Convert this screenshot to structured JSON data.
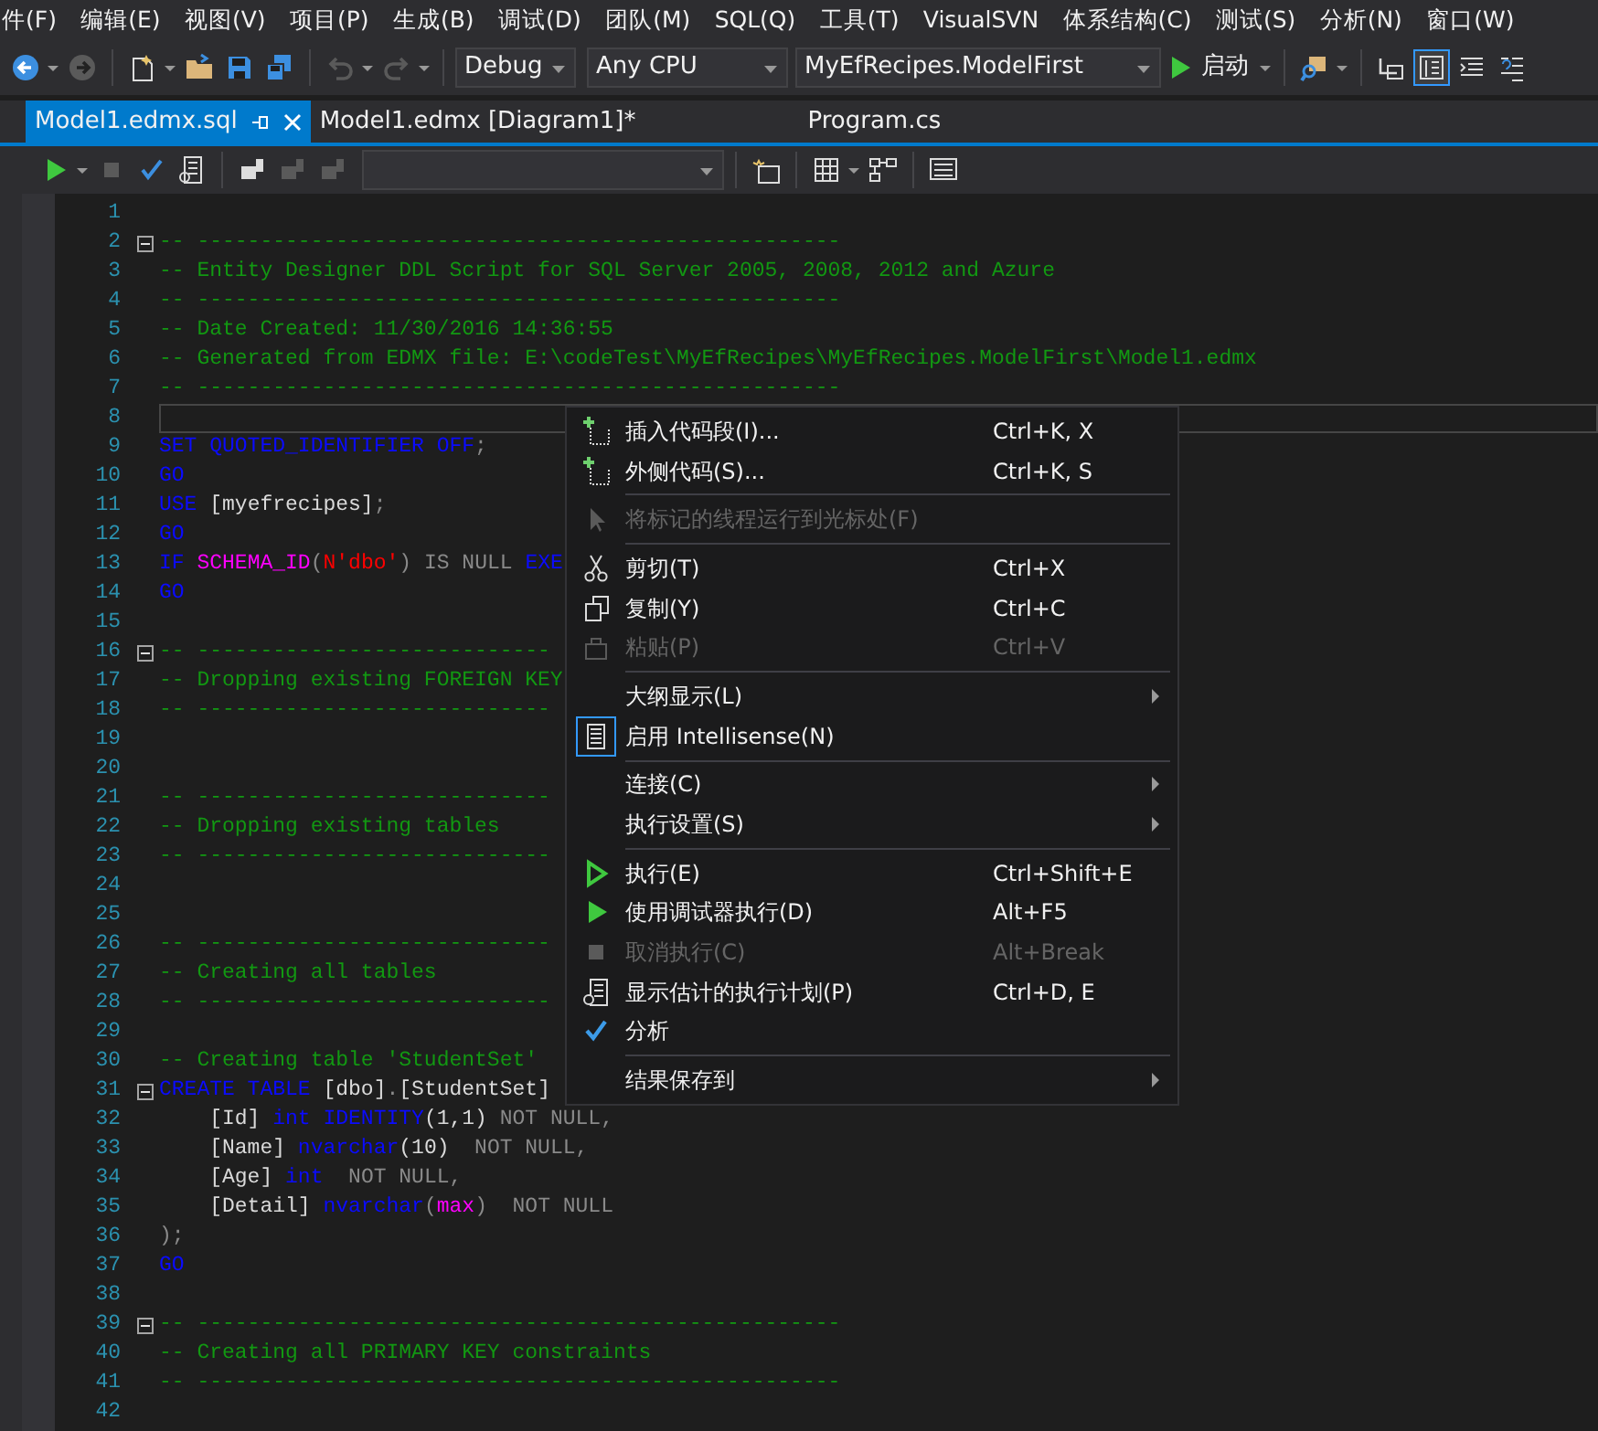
{
  "menu_bar": [
    "件(F)",
    "编辑(E)",
    "视图(V)",
    "项目(P)",
    "生成(B)",
    "调试(D)",
    "团队(M)",
    "SQL(Q)",
    "工具(T)",
    "VisualSVN",
    "体系结构(C)",
    "测试(S)",
    "分析(N)",
    "窗口(W)"
  ],
  "toolbar": {
    "icons": [
      {
        "disabled": false,
        "active": false
      },
      {
        "disabled": true,
        "active": false
      },
      {
        "disabled": false,
        "active": false
      },
      {
        "disabled": false,
        "active": false
      },
      {
        "disabled": false,
        "active": false
      },
      {
        "disabled": false,
        "active": false
      },
      {
        "disabled": true,
        "active": false
      },
      {
        "disabled": true,
        "active": false
      },
      {
        "disabled": false,
        "active": false
      },
      {
        "disabled": false,
        "active": false
      },
      {
        "disabled": false,
        "active": true
      },
      {
        "disabled": false,
        "active": false
      },
      {
        "disabled": false,
        "active": false
      }
    ],
    "configuration": "Debug",
    "platform": "Any CPU",
    "startup_project": "MyEfRecipes.ModelFirst",
    "start_button": "启动"
  },
  "tabs": [
    {
      "label": "Model1.edmx.sql",
      "selected": true
    },
    {
      "label": "Model1.edmx [Diagram1]*",
      "selected": false
    },
    {
      "label": "Program.cs",
      "selected": false
    }
  ],
  "editor_toolbar": {
    "icons": [
      {
        "disabled": false
      },
      {
        "disabled": true
      },
      {
        "disabled": false
      },
      {
        "disabled": false
      },
      {
        "disabled": false
      },
      {
        "disabled": true
      },
      {
        "disabled": true
      },
      {
        "disabled": false
      },
      {
        "disabled": false
      },
      {
        "disabled": false
      },
      {
        "disabled": false
      }
    ]
  },
  "code": {
    "lines": [
      {
        "n": "1",
        "fold": false,
        "current": false
      },
      {
        "n": "2",
        "fold": true,
        "current": false,
        "tokens": [
          {
            "kind": "comment",
            "t": "-- ---------------------------------------------------"
          }
        ]
      },
      {
        "n": "3",
        "fold": false,
        "current": false,
        "tokens": [
          {
            "kind": "comment",
            "t": "-- Entity Designer DDL Script for SQL Server 2005, 2008, 2012 and Azure"
          }
        ]
      },
      {
        "n": "4",
        "fold": false,
        "current": false,
        "tokens": [
          {
            "kind": "comment",
            "t": "-- ---------------------------------------------------"
          }
        ]
      },
      {
        "n": "5",
        "fold": false,
        "current": false,
        "tokens": [
          {
            "kind": "comment",
            "t": "-- Date Created: 11/30/2016 14:36:55"
          }
        ]
      },
      {
        "n": "6",
        "fold": false,
        "current": false,
        "tokens": [
          {
            "kind": "comment",
            "t": "-- Generated from EDMX file: E:\\codeTest\\MyEfRecipes\\MyEfRecipes.ModelFirst\\Model1.edmx"
          }
        ]
      },
      {
        "n": "7",
        "fold": false,
        "current": false,
        "tokens": [
          {
            "kind": "comment",
            "t": "-- ---------------------------------------------------"
          }
        ]
      },
      {
        "n": "8",
        "fold": false,
        "current": true
      },
      {
        "n": "9",
        "fold": false,
        "current": false,
        "tokens": [
          {
            "kind": "keyword",
            "t": "SET QUOTED_IDENTIFIER OFF"
          },
          {
            "kind": "punct",
            "t": ";"
          }
        ]
      },
      {
        "n": "10",
        "fold": false,
        "current": false,
        "tokens": [
          {
            "kind": "keyword",
            "t": "GO"
          }
        ]
      },
      {
        "n": "11",
        "fold": false,
        "current": false,
        "tokens": [
          {
            "kind": "keyword",
            "t": "USE"
          },
          {
            "kind": "plain",
            "t": " [myefrecipes]"
          },
          {
            "kind": "punct",
            "t": ";"
          }
        ]
      },
      {
        "n": "12",
        "fold": false,
        "current": false,
        "tokens": [
          {
            "kind": "keyword",
            "t": "GO"
          }
        ]
      },
      {
        "n": "13",
        "fold": false,
        "current": false,
        "tokens": [
          {
            "kind": "keyword",
            "t": "IF "
          },
          {
            "kind": "function",
            "t": "SCHEMA_ID"
          },
          {
            "kind": "punct",
            "t": "("
          },
          {
            "kind": "string",
            "t": "N'dbo'"
          },
          {
            "kind": "punct",
            "t": ") IS NULL "
          },
          {
            "kind": "keyword",
            "t": "EXE"
          }
        ]
      },
      {
        "n": "14",
        "fold": false,
        "current": false,
        "tokens": [
          {
            "kind": "keyword",
            "t": "GO"
          }
        ]
      },
      {
        "n": "15",
        "fold": false,
        "current": false
      },
      {
        "n": "16",
        "fold": true,
        "current": false,
        "tokens": [
          {
            "kind": "comment",
            "t": "-- ----------------------------"
          }
        ]
      },
      {
        "n": "17",
        "fold": false,
        "current": false,
        "tokens": [
          {
            "kind": "comment",
            "t": "-- Dropping existing FOREIGN KEY"
          }
        ]
      },
      {
        "n": "18",
        "fold": false,
        "current": false,
        "tokens": [
          {
            "kind": "comment",
            "t": "-- ----------------------------"
          }
        ]
      },
      {
        "n": "19",
        "fold": false,
        "current": false
      },
      {
        "n": "20",
        "fold": false,
        "current": false
      },
      {
        "n": "21",
        "fold": false,
        "current": false,
        "tokens": [
          {
            "kind": "comment",
            "t": "-- ----------------------------"
          }
        ]
      },
      {
        "n": "22",
        "fold": false,
        "current": false,
        "tokens": [
          {
            "kind": "comment",
            "t": "-- Dropping existing tables"
          }
        ]
      },
      {
        "n": "23",
        "fold": false,
        "current": false,
        "tokens": [
          {
            "kind": "comment",
            "t": "-- ----------------------------"
          }
        ]
      },
      {
        "n": "24",
        "fold": false,
        "current": false
      },
      {
        "n": "25",
        "fold": false,
        "current": false
      },
      {
        "n": "26",
        "fold": false,
        "current": false,
        "tokens": [
          {
            "kind": "comment",
            "t": "-- ----------------------------"
          }
        ]
      },
      {
        "n": "27",
        "fold": false,
        "current": false,
        "tokens": [
          {
            "kind": "comment",
            "t": "-- Creating all tables"
          }
        ]
      },
      {
        "n": "28",
        "fold": false,
        "current": false,
        "tokens": [
          {
            "kind": "comment",
            "t": "-- ----------------------------"
          }
        ]
      },
      {
        "n": "29",
        "fold": false,
        "current": false
      },
      {
        "n": "30",
        "fold": false,
        "current": false,
        "tokens": [
          {
            "kind": "comment",
            "t": "-- Creating table 'StudentSet'"
          }
        ]
      },
      {
        "n": "31",
        "fold": true,
        "current": false,
        "tokens": [
          {
            "kind": "keyword",
            "t": "CREATE TABLE"
          },
          {
            "kind": "plain",
            "t": " [dbo]"
          },
          {
            "kind": "punct",
            "t": "."
          },
          {
            "kind": "plain",
            "t": "[StudentSet]"
          }
        ]
      },
      {
        "n": "32",
        "fold": false,
        "current": false,
        "tokens": [
          {
            "kind": "plain",
            "t": "    [Id] "
          },
          {
            "kind": "keyword",
            "t": "int IDENTITY"
          },
          {
            "kind": "plain",
            "t": "(1,1)"
          },
          {
            "kind": "punct",
            "t": " NOT NULL,"
          }
        ]
      },
      {
        "n": "33",
        "fold": false,
        "current": false,
        "tokens": [
          {
            "kind": "plain",
            "t": "    [Name] "
          },
          {
            "kind": "keyword",
            "t": "nvarchar"
          },
          {
            "kind": "plain",
            "t": "(10)"
          },
          {
            "kind": "punct",
            "t": "  NOT NULL,"
          }
        ]
      },
      {
        "n": "34",
        "fold": false,
        "current": false,
        "tokens": [
          {
            "kind": "plain",
            "t": "    [Age] "
          },
          {
            "kind": "keyword",
            "t": "int"
          },
          {
            "kind": "punct",
            "t": "  NOT NULL,"
          }
        ]
      },
      {
        "n": "35",
        "fold": false,
        "current": false,
        "tokens": [
          {
            "kind": "plain",
            "t": "    [Detail] "
          },
          {
            "kind": "keyword",
            "t": "nvarchar"
          },
          {
            "kind": "punct",
            "t": "("
          },
          {
            "kind": "function",
            "t": "max"
          },
          {
            "kind": "punct",
            "t": ")  NOT NULL"
          }
        ]
      },
      {
        "n": "36",
        "fold": false,
        "current": false,
        "tokens": [
          {
            "kind": "punct",
            "t": ");"
          }
        ]
      },
      {
        "n": "37",
        "fold": false,
        "current": false,
        "tokens": [
          {
            "kind": "keyword",
            "t": "GO"
          }
        ]
      },
      {
        "n": "38",
        "fold": false,
        "current": false
      },
      {
        "n": "39",
        "fold": true,
        "current": false,
        "tokens": [
          {
            "kind": "comment",
            "t": "-- ---------------------------------------------------"
          }
        ]
      },
      {
        "n": "40",
        "fold": false,
        "current": false,
        "tokens": [
          {
            "kind": "comment",
            "t": "-- Creating all PRIMARY KEY constraints"
          }
        ]
      },
      {
        "n": "41",
        "fold": false,
        "current": false,
        "tokens": [
          {
            "kind": "comment",
            "t": "-- ---------------------------------------------------"
          }
        ]
      },
      {
        "n": "42",
        "fold": false,
        "current": false
      }
    ]
  },
  "context_menu": {
    "items": [
      {
        "kind": "item",
        "label": "插入代码段(I)...",
        "shortcut": "Ctrl+K, X",
        "disabled": false,
        "checked": false,
        "submenu": false
      },
      {
        "kind": "item",
        "label": "外侧代码(S)...",
        "shortcut": "Ctrl+K, S",
        "disabled": false,
        "checked": false,
        "submenu": false
      },
      {
        "kind": "separator"
      },
      {
        "kind": "item",
        "label": "将标记的线程运行到光标处(F)",
        "disabled": true,
        "checked": false,
        "submenu": false
      },
      {
        "kind": "separator"
      },
      {
        "kind": "item",
        "label": "剪切(T)",
        "shortcut": "Ctrl+X",
        "disabled": false,
        "checked": false,
        "submenu": false
      },
      {
        "kind": "item",
        "label": "复制(Y)",
        "shortcut": "Ctrl+C",
        "disabled": false,
        "checked": false,
        "submenu": false
      },
      {
        "kind": "item",
        "label": "粘贴(P)",
        "shortcut": "Ctrl+V",
        "disabled": true,
        "checked": false,
        "submenu": false
      },
      {
        "kind": "separator"
      },
      {
        "kind": "item",
        "label": "大纲显示(L)",
        "disabled": false,
        "checked": false,
        "submenu": true
      },
      {
        "kind": "item",
        "label": "启用 Intellisense(N)",
        "disabled": false,
        "checked": true,
        "submenu": false
      },
      {
        "kind": "separator"
      },
      {
        "kind": "item",
        "label": "连接(C)",
        "disabled": false,
        "checked": false,
        "submenu": true
      },
      {
        "kind": "item",
        "label": "执行设置(S)",
        "disabled": false,
        "checked": false,
        "submenu": true
      },
      {
        "kind": "separator"
      },
      {
        "kind": "item",
        "label": "执行(E)",
        "shortcut": "Ctrl+Shift+E",
        "disabled": false,
        "checked": false,
        "submenu": false
      },
      {
        "kind": "item",
        "label": "使用调试器执行(D)",
        "shortcut": "Alt+F5",
        "disabled": false,
        "checked": false,
        "submenu": false
      },
      {
        "kind": "item",
        "label": "取消执行(C)",
        "shortcut": "Alt+Break",
        "disabled": true,
        "checked": false,
        "submenu": false
      },
      {
        "kind": "item",
        "label": "显示估计的执行计划(P)",
        "shortcut": "Ctrl+D, E",
        "disabled": false,
        "checked": false,
        "submenu": false
      },
      {
        "kind": "item",
        "label": "分析",
        "disabled": false,
        "checked": true,
        "submenu": false
      },
      {
        "kind": "separator"
      },
      {
        "kind": "item",
        "label": "结果保存到",
        "disabled": false,
        "checked": false,
        "submenu": true
      }
    ]
  }
}
